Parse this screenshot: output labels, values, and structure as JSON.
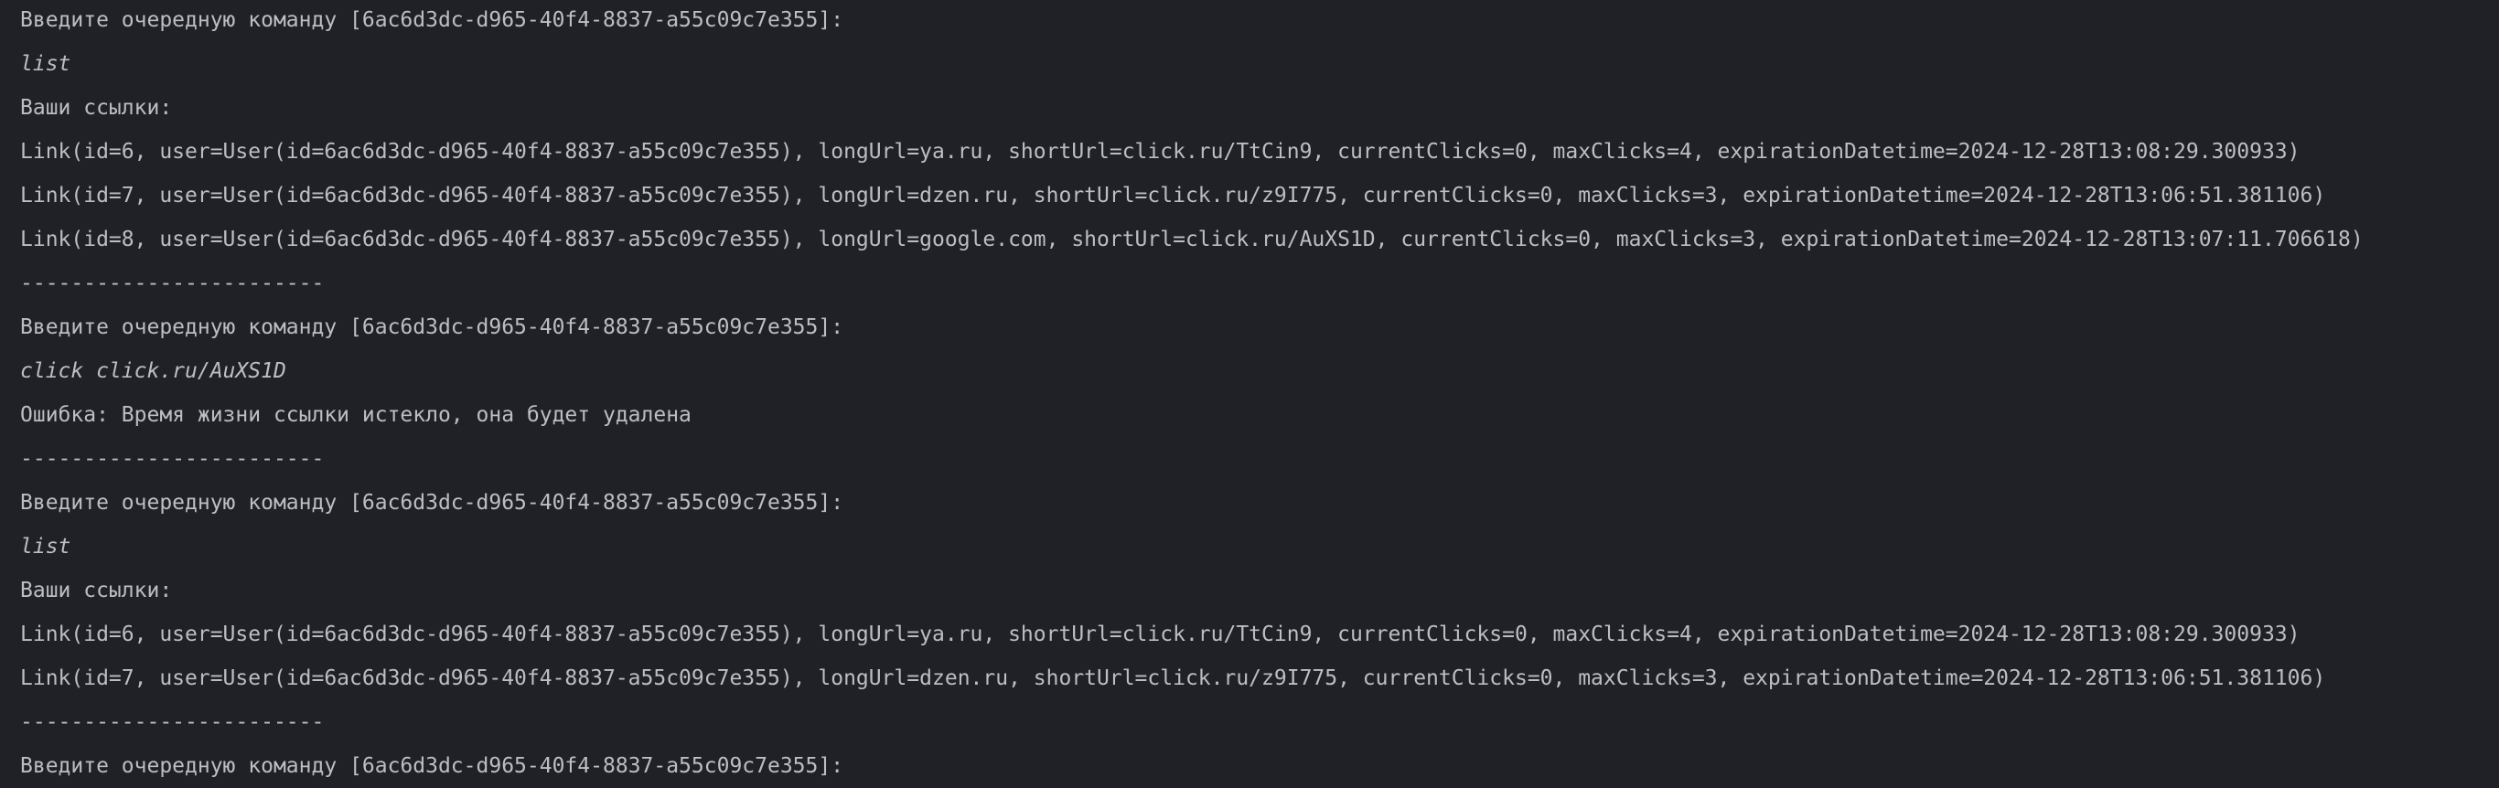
{
  "console": {
    "lines": [
      {
        "kind": "prompt",
        "text": "Введите очередную команду [6ac6d3dc-d965-40f4-8837-a55c09c7e355]:"
      },
      {
        "kind": "input",
        "text": "list"
      },
      {
        "kind": "output",
        "text": "Ваши ссылки:"
      },
      {
        "kind": "output",
        "text": "Link(id=6, user=User(id=6ac6d3dc-d965-40f4-8837-a55c09c7e355), longUrl=ya.ru, shortUrl=click.ru/TtCin9, currentClicks=0, maxClicks=4, expirationDatetime=2024-12-28T13:08:29.300933)"
      },
      {
        "kind": "output",
        "text": "Link(id=7, user=User(id=6ac6d3dc-d965-40f4-8837-a55c09c7e355), longUrl=dzen.ru, shortUrl=click.ru/z9I775, currentClicks=0, maxClicks=3, expirationDatetime=2024-12-28T13:06:51.381106)"
      },
      {
        "kind": "output",
        "text": "Link(id=8, user=User(id=6ac6d3dc-d965-40f4-8837-a55c09c7e355), longUrl=google.com, shortUrl=click.ru/AuXS1D, currentClicks=0, maxClicks=3, expirationDatetime=2024-12-28T13:07:11.706618)"
      },
      {
        "kind": "separator",
        "text": "------------------------"
      },
      {
        "kind": "prompt",
        "text": "Введите очередную команду [6ac6d3dc-d965-40f4-8837-a55c09c7e355]:"
      },
      {
        "kind": "input",
        "text": "click click.ru/AuXS1D"
      },
      {
        "kind": "output",
        "text": "Ошибка: Время жизни ссылки истекло, она будет удалена"
      },
      {
        "kind": "separator",
        "text": "------------------------"
      },
      {
        "kind": "prompt",
        "text": "Введите очередную команду [6ac6d3dc-d965-40f4-8837-a55c09c7e355]:"
      },
      {
        "kind": "input",
        "text": "list"
      },
      {
        "kind": "output",
        "text": "Ваши ссылки:"
      },
      {
        "kind": "output",
        "text": "Link(id=6, user=User(id=6ac6d3dc-d965-40f4-8837-a55c09c7e355), longUrl=ya.ru, shortUrl=click.ru/TtCin9, currentClicks=0, maxClicks=4, expirationDatetime=2024-12-28T13:08:29.300933)"
      },
      {
        "kind": "output",
        "text": "Link(id=7, user=User(id=6ac6d3dc-d965-40f4-8837-a55c09c7e355), longUrl=dzen.ru, shortUrl=click.ru/z9I775, currentClicks=0, maxClicks=3, expirationDatetime=2024-12-28T13:06:51.381106)"
      },
      {
        "kind": "separator",
        "text": "------------------------"
      },
      {
        "kind": "prompt",
        "text": "Введите очередную команду [6ac6d3dc-d965-40f4-8837-a55c09c7e355]:"
      }
    ]
  }
}
